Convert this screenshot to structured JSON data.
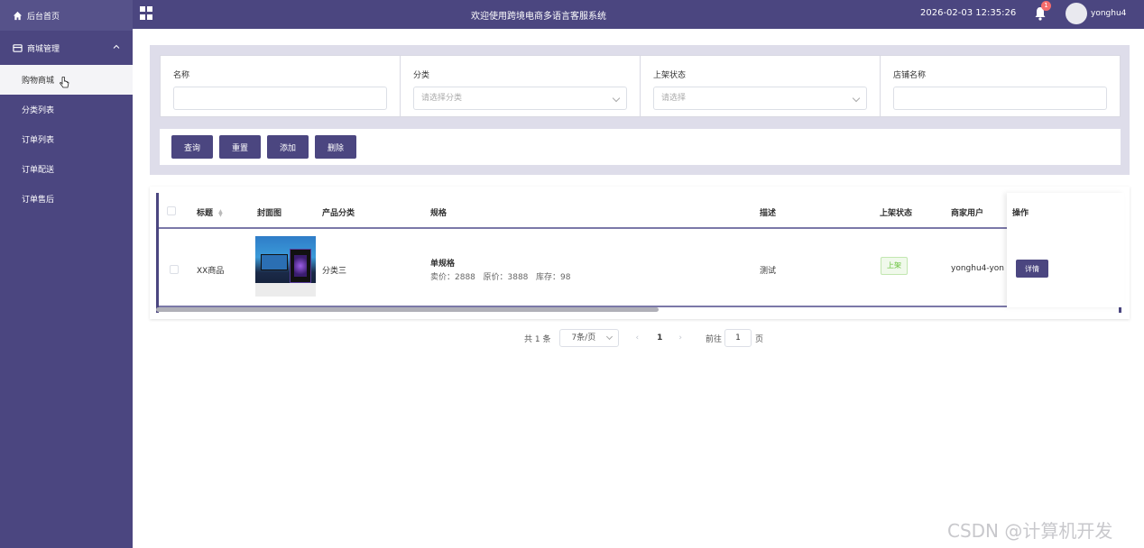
{
  "sidebar": {
    "home": "后台首页",
    "group": "商城管理",
    "items": [
      "购物商城",
      "分类列表",
      "订单列表",
      "订单配送",
      "订单售后"
    ]
  },
  "header": {
    "title": "欢迎使用跨境电商多语言客服系统",
    "datetime": "2026-02-03 12:35:26",
    "badge": "1",
    "username": "yonghu4"
  },
  "search": {
    "fields": [
      {
        "label": "名称",
        "placeholder": ""
      },
      {
        "label": "分类",
        "placeholder": "请选择分类"
      },
      {
        "label": "上架状态",
        "placeholder": "请选择"
      },
      {
        "label": "店铺名称",
        "placeholder": ""
      }
    ],
    "buttons": [
      "查询",
      "重置",
      "添加",
      "删除"
    ]
  },
  "table": {
    "headers": [
      "标题",
      "封面图",
      "产品分类",
      "规格",
      "描述",
      "上架状态",
      "商家用户",
      "操作"
    ],
    "row": {
      "title": "XX商品",
      "category": "分类三",
      "spec_title": "单规格",
      "spec_detail": "卖价：2888   原价：3888   库存：98",
      "desc": "测试",
      "status": "上架",
      "merchant": "yonghu4-yon",
      "action": "详情"
    }
  },
  "pagination": {
    "total": "共 1 条",
    "page_size": "7条/页",
    "prev": "‹",
    "current": "1",
    "next": "›",
    "goto": "前往",
    "goto_value": "1",
    "page_unit": "页"
  },
  "watermark": "CSDN @计算机开发",
  "colors": {
    "primary": "#4b4680",
    "panel": "#deddea"
  }
}
